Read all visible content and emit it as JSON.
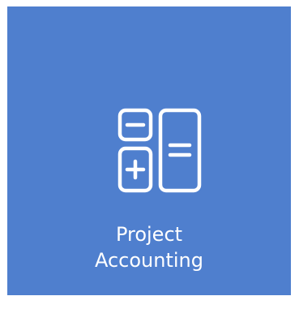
{
  "tile": {
    "label_line1": "Project",
    "label_line2": "Accounting",
    "icon": "calculator-icon",
    "background_color": "#4f7fce",
    "foreground_color": "#ffffff"
  }
}
